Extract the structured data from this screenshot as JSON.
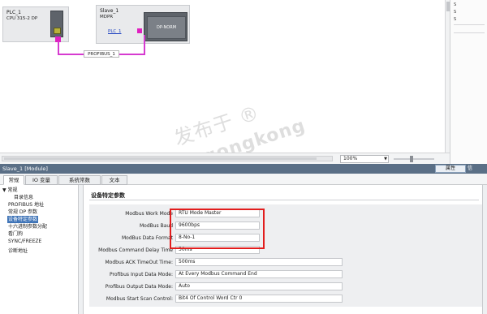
{
  "network": {
    "plc": {
      "name": "PLC_1",
      "cpu": "CPU 315-2 DP"
    },
    "slave": {
      "name": "Slave_1",
      "type": "MDPR",
      "link": "PLC_1",
      "module_label": "DP-NORM"
    },
    "bus_label": "PROFIBUS_1",
    "watermark_line1": "发布于 ®",
    "watermark_line2": "gongkong"
  },
  "canvas_toolbar": {
    "zoom": "100%"
  },
  "right_panel": {
    "items": [
      "S",
      "S",
      "S"
    ]
  },
  "properties_panel": {
    "title": "Slave_1 [Module]",
    "properties_tab": "属性",
    "info_tab": "信",
    "tabs": [
      {
        "label": "常规"
      },
      {
        "label": "IO 变量"
      },
      {
        "label": "系统常数"
      },
      {
        "label": "文本"
      }
    ],
    "nav": [
      "▼ 常规",
      "目录信息",
      "PROFIBUS 地址",
      "常规 DP 参数",
      "设备特定参数",
      "十六进制参数分配",
      "看门狗",
      "SYNC/FREEZE",
      "诊断地址"
    ],
    "section_title": "设备特定参数",
    "params": [
      {
        "label": "Modbus Work Mode",
        "value": "RTU Mode Master"
      },
      {
        "label": "ModBus Baud",
        "value": "9600bps"
      },
      {
        "label": "ModBus Data Format",
        "value": "8-No-1"
      },
      {
        "label": "Modbus Command Delay Time",
        "value": "50ms"
      },
      {
        "label": "Modbus ACK TimeOut Time:",
        "value": "500ms"
      },
      {
        "label": "Profibus Input Data Mode:",
        "value": "At Every Modbus Command End"
      },
      {
        "label": "Profibus Output Data Mode:",
        "value": "Auto"
      },
      {
        "label": "Modbus Start Scan Control:",
        "value": "Bit4 Of Control Word Ctr 0"
      }
    ]
  },
  "colors": {
    "bus": "#d63ad0",
    "titlebar": "#5a6f86",
    "selected": "#3f74b7",
    "highlight": "#e21d1d"
  }
}
